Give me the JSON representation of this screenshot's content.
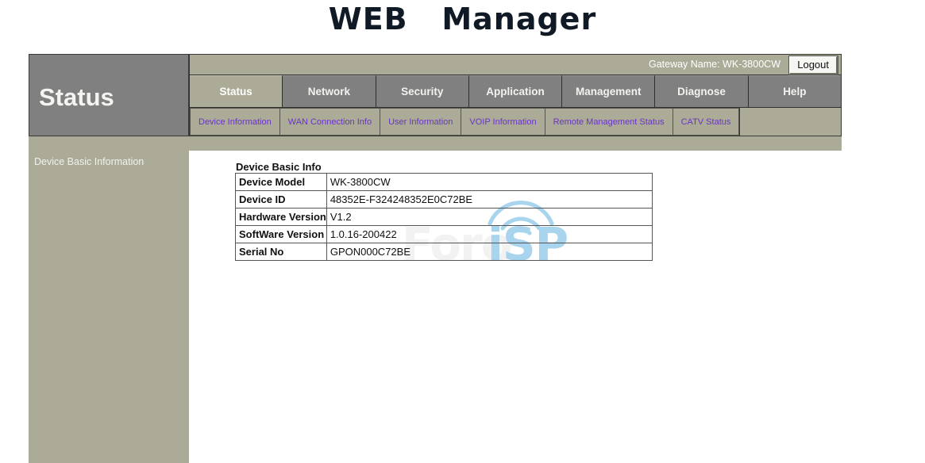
{
  "page": {
    "title": "WEB   Manager"
  },
  "sidebar": {
    "header_label": "Status",
    "items": [
      {
        "label": "Device Basic Information",
        "name": "sidebar-item-device-basic-information"
      }
    ]
  },
  "topbar": {
    "gateway_label": "Gateway Name: WK-3800CW",
    "logout_label": "Logout"
  },
  "nav": {
    "tabs": [
      {
        "label": "Status",
        "active": true
      },
      {
        "label": "Network",
        "active": false
      },
      {
        "label": "Security",
        "active": false
      },
      {
        "label": "Application",
        "active": false
      },
      {
        "label": "Management",
        "active": false
      },
      {
        "label": "Diagnose",
        "active": false
      },
      {
        "label": "Help",
        "active": false
      }
    ]
  },
  "subnav": {
    "items": [
      {
        "label": "Device Information",
        "active": true
      },
      {
        "label": "WAN Connection Info",
        "active": false
      },
      {
        "label": "User Information",
        "active": false
      },
      {
        "label": "VOIP Information",
        "active": false
      },
      {
        "label": "Remote Management Status",
        "active": false
      },
      {
        "label": "CATV Status",
        "active": false
      }
    ]
  },
  "content": {
    "section_title": "Device Basic Info",
    "rows": [
      {
        "label": "Device Model",
        "value": "WK-3800CW"
      },
      {
        "label": "Device ID",
        "value": "48352E-F324248352E0C72BE"
      },
      {
        "label": "Hardware Version",
        "value": "V1.2"
      },
      {
        "label": "SoftWare Version",
        "value": "1.0.16-200422"
      },
      {
        "label": "Serial No",
        "value": "GPON000C72BE"
      }
    ]
  },
  "watermark": {
    "text_left": "Foro",
    "text_right": "iSP"
  },
  "colors": {
    "tan": "#ABAB97",
    "gray": "#808080",
    "link_purple": "#6A35C4",
    "watermark_blue": "#A8D4EE",
    "title_dark": "#0F1A26"
  }
}
